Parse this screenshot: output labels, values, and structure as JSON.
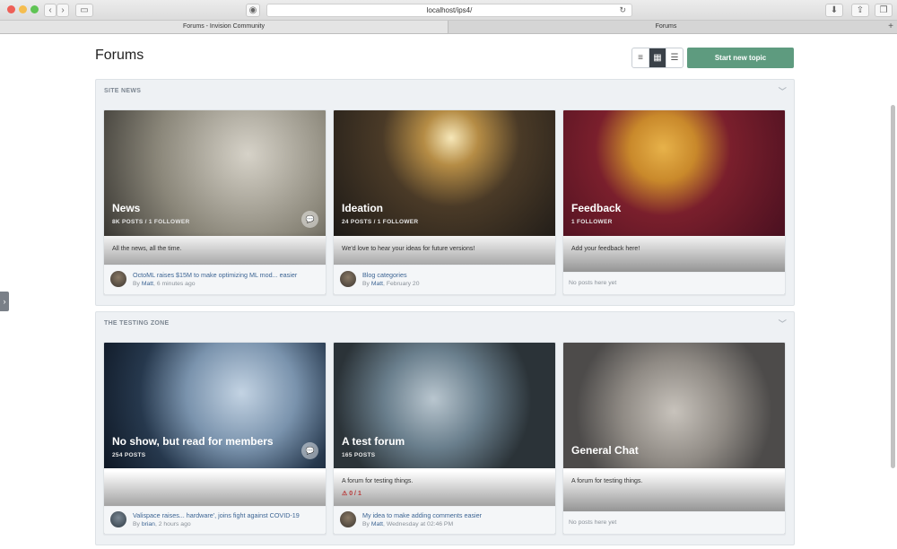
{
  "browser": {
    "url": "localhost/ips4/",
    "tabs": [
      {
        "label": "Forums - Invision Community"
      },
      {
        "label": "Forums"
      }
    ],
    "new_tab_symbol": "+"
  },
  "page": {
    "title": "Forums",
    "start_topic_label": "Start new topic",
    "view_modes": [
      "table-view-icon",
      "grid-view-icon",
      "fluid-view-icon"
    ],
    "active_view": "grid-view-icon",
    "accent_color": "#5e9b7f"
  },
  "categories": [
    {
      "title": "SITE NEWS",
      "forums": [
        {
          "name": "News",
          "stats": "8K POSTS   /   1 FOLLOWER",
          "description": "All the news, all the time.",
          "last_post_title": "OctoML raises $15M to make optimizing ML mod... easier",
          "last_post_by": "By ",
          "last_post_author": "Matt",
          "last_post_time": ", 6 minutes ago",
          "chat_icon": true
        },
        {
          "name": "Ideation",
          "stats": "24 POSTS   /   1 FOLLOWER",
          "description": "We'd love to hear your ideas for future versions!",
          "last_post_title": "Blog categories",
          "last_post_by": "By ",
          "last_post_author": "Matt",
          "last_post_time": ", February 20"
        },
        {
          "name": "Feedback",
          "stats": "1 FOLLOWER",
          "description": "Add your feedback here!",
          "no_posts": "No posts here yet"
        }
      ]
    },
    {
      "title": "THE TESTING ZONE",
      "forums": [
        {
          "name": "No show, but read for members",
          "stats": "254 POSTS",
          "description": "",
          "last_post_title": "Valispace raises... hardware', joins fight against COVID-19",
          "last_post_by": "By ",
          "last_post_author": "brian",
          "last_post_time": ", 2 hours ago",
          "chat_icon": true
        },
        {
          "name": "A test forum",
          "stats": "165 POSTS",
          "description": "A forum for testing things.",
          "warning": "⚠ 0 / 1",
          "last_post_title": "My idea to make adding comments easier",
          "last_post_by": "By ",
          "last_post_author": "Matt",
          "last_post_time": ", Wednesday at 02:46 PM"
        },
        {
          "name": "General Chat",
          "stats": "",
          "description": "A forum for testing things.",
          "no_posts": "No posts here yet"
        }
      ]
    }
  ]
}
